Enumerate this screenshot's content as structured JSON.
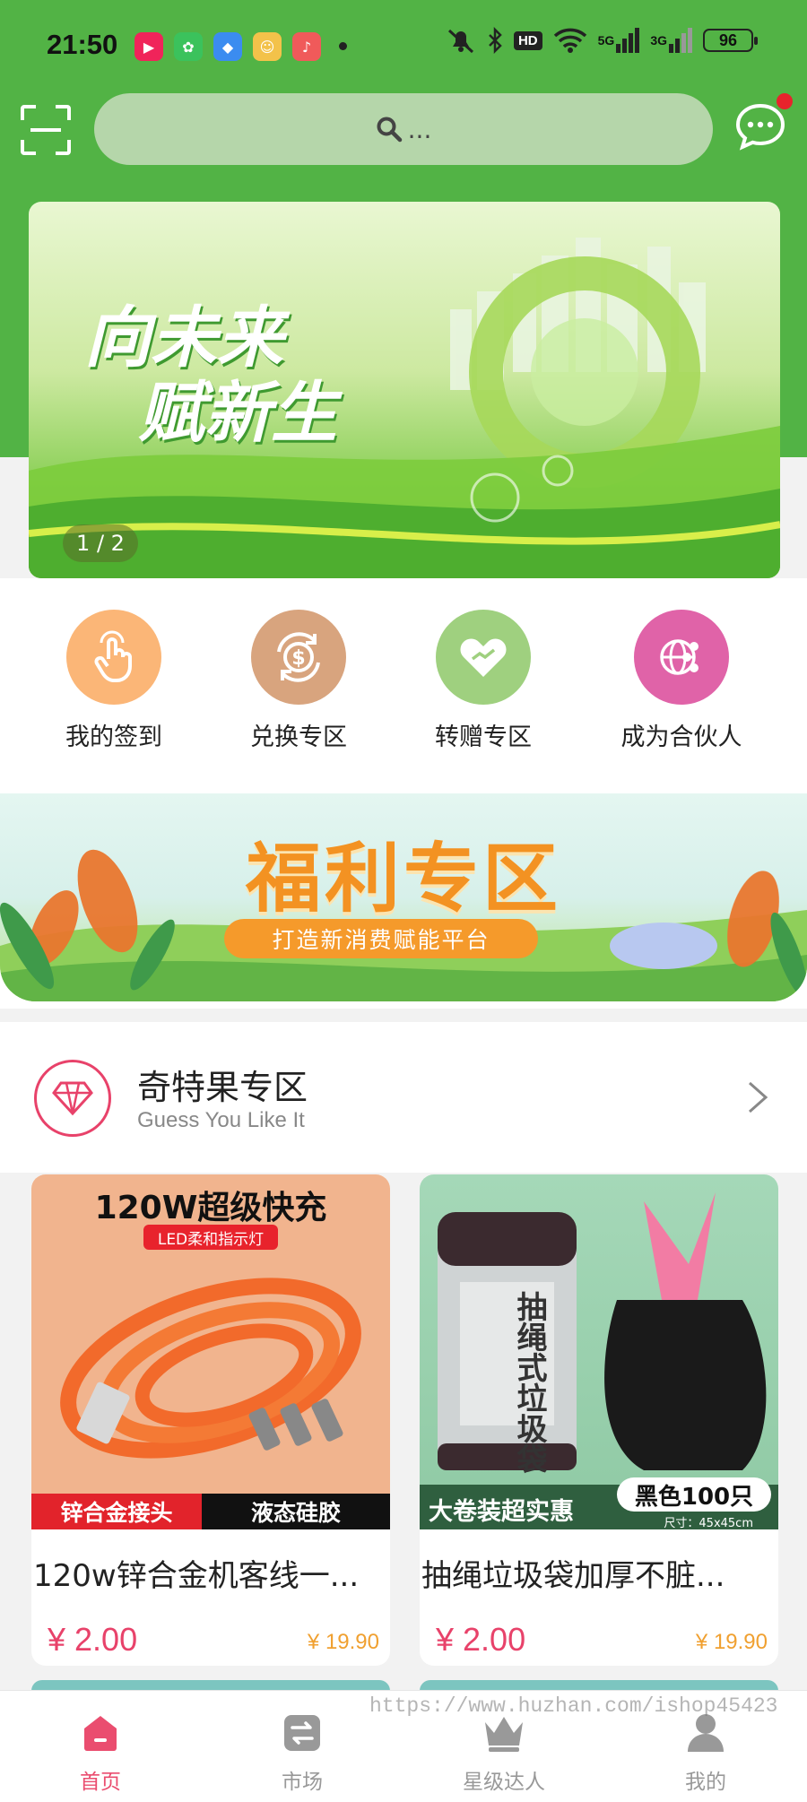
{
  "status_bar": {
    "time": "21:50",
    "network_labels": [
      "5G",
      "3G"
    ],
    "hd_label": "HD",
    "battery": "96"
  },
  "search": {
    "placeholder": "..."
  },
  "banner": {
    "line1": "向未来",
    "line2": "赋新生",
    "indicator": "1 / 2"
  },
  "quick_menu": [
    {
      "label": "我的签到",
      "icon": "hand-tap-icon",
      "color": "#fbb677"
    },
    {
      "label": "兑换专区",
      "icon": "dollar-exchange-icon",
      "color": "#d8a47e"
    },
    {
      "label": "转赠专区",
      "icon": "heart-handshake-icon",
      "color": "#9fd07f"
    },
    {
      "label": "成为合伙人",
      "icon": "globe-share-icon",
      "color": "#e063a8"
    }
  ],
  "welfare": {
    "title": "福利专区",
    "subtitle": "打造新消费赋能平台"
  },
  "section": {
    "title": "奇特果专区",
    "subtitle": "Guess You Like It"
  },
  "products": [
    {
      "name": "120w锌合金机客线一...",
      "price": "¥ 2.00",
      "original_price": "¥ 19.90",
      "image_text": {
        "headline": "120W超级快充",
        "tag": "LED柔和指示灯",
        "bar_left": "锌合金接头",
        "bar_right": "液态硅胶"
      }
    },
    {
      "name": "抽绳垃圾袋加厚不脏...",
      "price": "¥ 2.00",
      "original_price": "¥ 19.90",
      "image_text": {
        "roll_label": "抽绳式垃圾袋",
        "bar_left": "大卷装超实惠",
        "pill": "黑色100只",
        "size": "尺寸：45x45cm"
      }
    }
  ],
  "tab_bar": [
    {
      "label": "首页",
      "icon": "home-icon",
      "active": true
    },
    {
      "label": "市场",
      "icon": "exchange-icon",
      "active": false
    },
    {
      "label": "星级达人",
      "icon": "crown-icon",
      "active": false
    },
    {
      "label": "我的",
      "icon": "user-icon",
      "active": false
    }
  ],
  "watermark": "https://www.huzhan.com/ishop45423",
  "colors": {
    "brand_green": "#52b345",
    "accent_pink": "#ea4d6f",
    "price_red": "#e8426a",
    "original_price": "#f0a030"
  }
}
